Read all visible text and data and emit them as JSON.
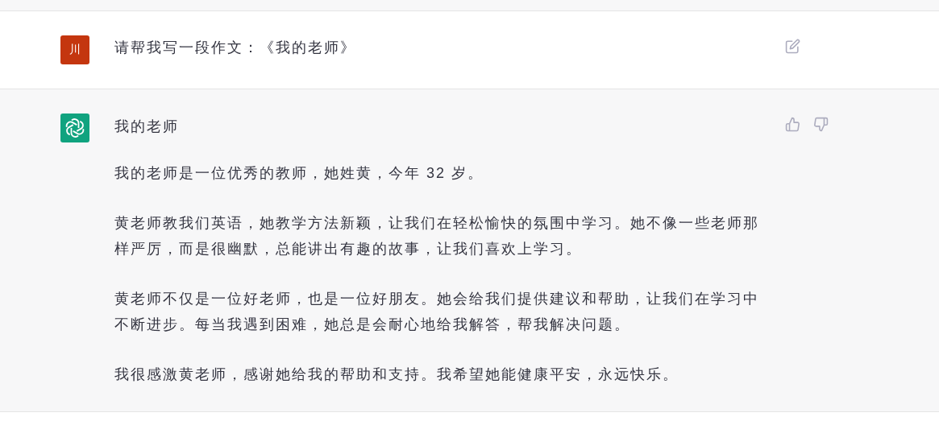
{
  "messages": [
    {
      "kind": "user",
      "avatar": "川",
      "text": "请帮我写一段作文：《我的老师》"
    },
    {
      "kind": "assistant",
      "title": "我的老师",
      "paragraphs": [
        "我的老师是一位优秀的教师，她姓黄，今年 32 岁。",
        "黄老师教我们英语，她教学方法新颖，让我们在轻松愉快的氛围中学习。她不像一些老师那样严厉，而是很幽默，总能讲出有趣的故事，让我们喜欢上学习。",
        "黄老师不仅是一位好老师，也是一位好朋友。她会给我们提供建议和帮助，让我们在学习中不断进步。每当我遇到困难，她总是会耐心地给我解答，帮我解决问题。",
        "我很感激黄老师，感谢她给我的帮助和支持。我希望她能健康平安，永远快乐。"
      ]
    }
  ]
}
